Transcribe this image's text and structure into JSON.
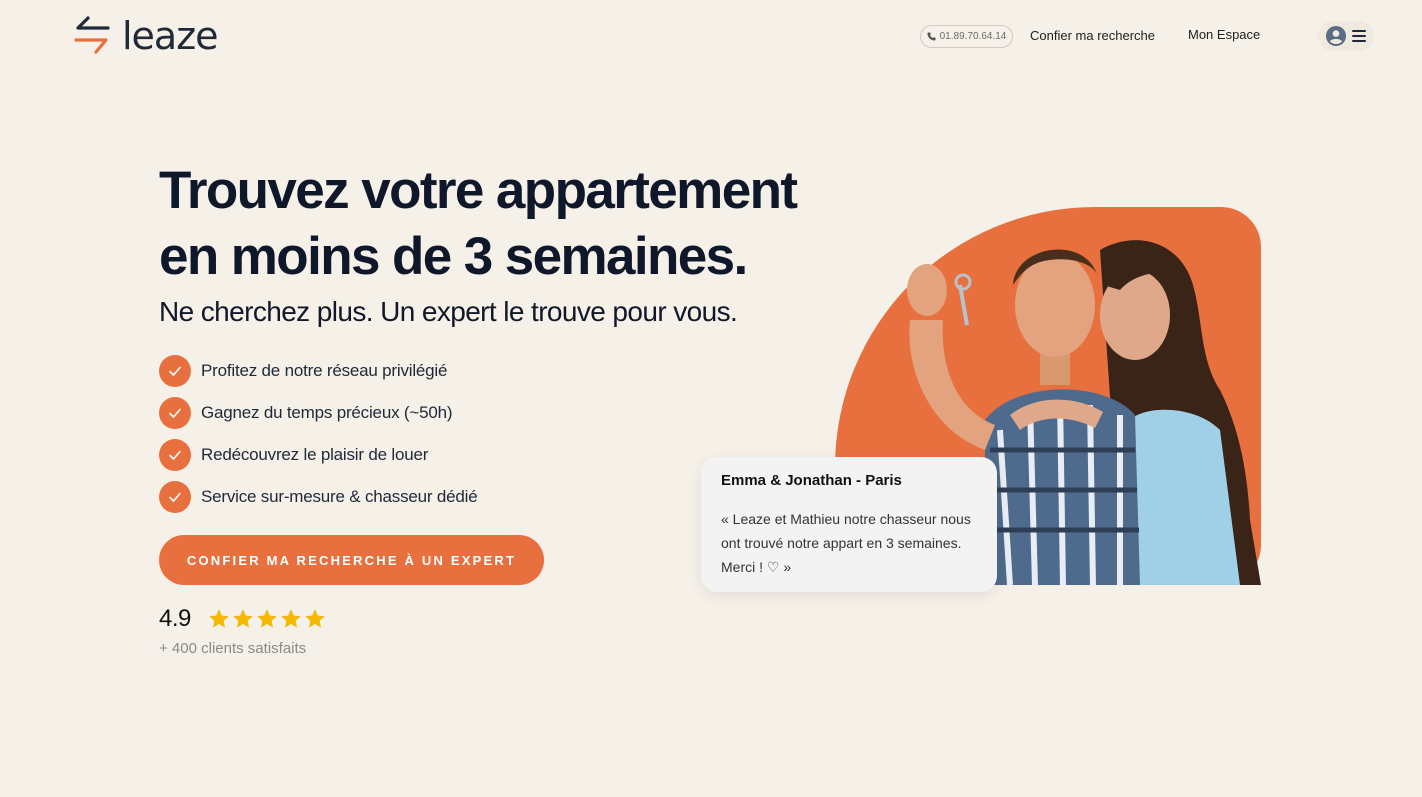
{
  "brand": {
    "name": "leaze",
    "accent_color": "#e8703f",
    "logo_icon": "leaze-arrows-logo"
  },
  "header": {
    "phone": "01.89.70.64.14",
    "phone_icon": "phone-icon",
    "nav": {
      "confier": "Confier ma recherche",
      "espace": "Mon Espace"
    },
    "menu_icons": [
      "user-icon",
      "hamburger-menu-icon"
    ]
  },
  "hero": {
    "title": "Trouvez votre appartement en moins de 3 semaines.",
    "subtitle": "Ne cherchez plus. Un expert le trouve pour vous.",
    "features": [
      "Profitez de notre réseau privilégié",
      "Gagnez du temps précieux (~50h)",
      "Redécouvrez le plaisir de louer",
      "Service sur-mesure & chasseur dédié"
    ],
    "cta": "CONFIER MA RECHERCHE À UN EXPERT",
    "rating": {
      "value": "4.9",
      "stars": 5,
      "caption": "+ 400 clients satisfaits"
    }
  },
  "testimonial": {
    "author": "Emma & Jonathan - Paris",
    "quote": "« Leaze et Mathieu notre chasseur nous ont trouvé notre appart en 3 semaines. Merci ! ♡ »"
  }
}
